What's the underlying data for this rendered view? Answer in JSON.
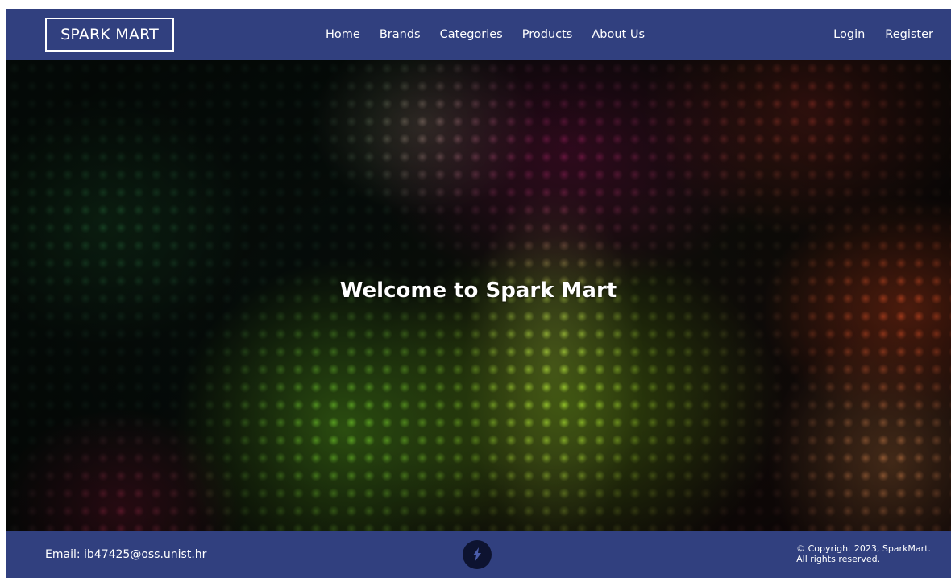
{
  "header": {
    "brand": "SPARK MART",
    "nav": [
      {
        "label": "Home"
      },
      {
        "label": "Brands"
      },
      {
        "label": "Categories"
      },
      {
        "label": "Products"
      },
      {
        "label": "About Us"
      }
    ],
    "auth": {
      "login": "Login",
      "register": "Register"
    }
  },
  "hero": {
    "title": "Welcome to Spark Mart"
  },
  "footer": {
    "email": "Email: ib47425@oss.unist.hr",
    "logo_icon": "spark-lightning-icon",
    "copyright_line1": "© Copyright 2023, SparkMart.",
    "copyright_line2": "All rights reserved."
  },
  "colors": {
    "bar_background": "#31407f",
    "text": "#ffffff",
    "logo_circle": "#0d1330"
  }
}
